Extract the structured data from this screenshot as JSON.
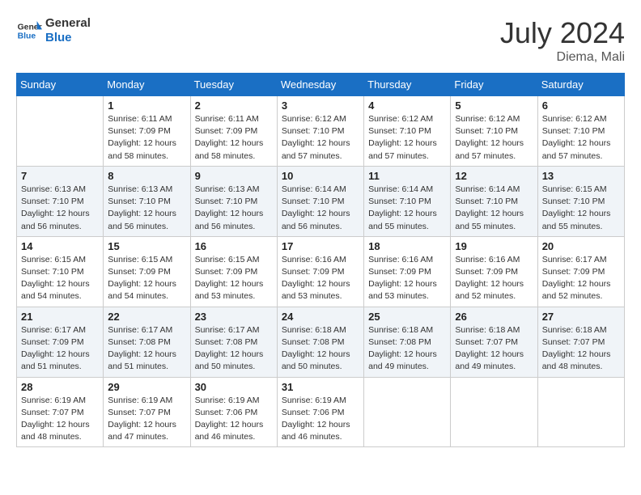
{
  "header": {
    "logo_general": "General",
    "logo_blue": "Blue",
    "month": "July 2024",
    "location": "Diema, Mali"
  },
  "weekdays": [
    "Sunday",
    "Monday",
    "Tuesday",
    "Wednesday",
    "Thursday",
    "Friday",
    "Saturday"
  ],
  "weeks": [
    [
      {
        "day": "",
        "sunrise": "",
        "sunset": "",
        "daylight": ""
      },
      {
        "day": "1",
        "sunrise": "Sunrise: 6:11 AM",
        "sunset": "Sunset: 7:09 PM",
        "daylight": "Daylight: 12 hours and 58 minutes."
      },
      {
        "day": "2",
        "sunrise": "Sunrise: 6:11 AM",
        "sunset": "Sunset: 7:09 PM",
        "daylight": "Daylight: 12 hours and 58 minutes."
      },
      {
        "day": "3",
        "sunrise": "Sunrise: 6:12 AM",
        "sunset": "Sunset: 7:10 PM",
        "daylight": "Daylight: 12 hours and 57 minutes."
      },
      {
        "day": "4",
        "sunrise": "Sunrise: 6:12 AM",
        "sunset": "Sunset: 7:10 PM",
        "daylight": "Daylight: 12 hours and 57 minutes."
      },
      {
        "day": "5",
        "sunrise": "Sunrise: 6:12 AM",
        "sunset": "Sunset: 7:10 PM",
        "daylight": "Daylight: 12 hours and 57 minutes."
      },
      {
        "day": "6",
        "sunrise": "Sunrise: 6:12 AM",
        "sunset": "Sunset: 7:10 PM",
        "daylight": "Daylight: 12 hours and 57 minutes."
      }
    ],
    [
      {
        "day": "7",
        "sunrise": "Sunrise: 6:13 AM",
        "sunset": "Sunset: 7:10 PM",
        "daylight": "Daylight: 12 hours and 56 minutes."
      },
      {
        "day": "8",
        "sunrise": "Sunrise: 6:13 AM",
        "sunset": "Sunset: 7:10 PM",
        "daylight": "Daylight: 12 hours and 56 minutes."
      },
      {
        "day": "9",
        "sunrise": "Sunrise: 6:13 AM",
        "sunset": "Sunset: 7:10 PM",
        "daylight": "Daylight: 12 hours and 56 minutes."
      },
      {
        "day": "10",
        "sunrise": "Sunrise: 6:14 AM",
        "sunset": "Sunset: 7:10 PM",
        "daylight": "Daylight: 12 hours and 56 minutes."
      },
      {
        "day": "11",
        "sunrise": "Sunrise: 6:14 AM",
        "sunset": "Sunset: 7:10 PM",
        "daylight": "Daylight: 12 hours and 55 minutes."
      },
      {
        "day": "12",
        "sunrise": "Sunrise: 6:14 AM",
        "sunset": "Sunset: 7:10 PM",
        "daylight": "Daylight: 12 hours and 55 minutes."
      },
      {
        "day": "13",
        "sunrise": "Sunrise: 6:15 AM",
        "sunset": "Sunset: 7:10 PM",
        "daylight": "Daylight: 12 hours and 55 minutes."
      }
    ],
    [
      {
        "day": "14",
        "sunrise": "Sunrise: 6:15 AM",
        "sunset": "Sunset: 7:10 PM",
        "daylight": "Daylight: 12 hours and 54 minutes."
      },
      {
        "day": "15",
        "sunrise": "Sunrise: 6:15 AM",
        "sunset": "Sunset: 7:09 PM",
        "daylight": "Daylight: 12 hours and 54 minutes."
      },
      {
        "day": "16",
        "sunrise": "Sunrise: 6:15 AM",
        "sunset": "Sunset: 7:09 PM",
        "daylight": "Daylight: 12 hours and 53 minutes."
      },
      {
        "day": "17",
        "sunrise": "Sunrise: 6:16 AM",
        "sunset": "Sunset: 7:09 PM",
        "daylight": "Daylight: 12 hours and 53 minutes."
      },
      {
        "day": "18",
        "sunrise": "Sunrise: 6:16 AM",
        "sunset": "Sunset: 7:09 PM",
        "daylight": "Daylight: 12 hours and 53 minutes."
      },
      {
        "day": "19",
        "sunrise": "Sunrise: 6:16 AM",
        "sunset": "Sunset: 7:09 PM",
        "daylight": "Daylight: 12 hours and 52 minutes."
      },
      {
        "day": "20",
        "sunrise": "Sunrise: 6:17 AM",
        "sunset": "Sunset: 7:09 PM",
        "daylight": "Daylight: 12 hours and 52 minutes."
      }
    ],
    [
      {
        "day": "21",
        "sunrise": "Sunrise: 6:17 AM",
        "sunset": "Sunset: 7:09 PM",
        "daylight": "Daylight: 12 hours and 51 minutes."
      },
      {
        "day": "22",
        "sunrise": "Sunrise: 6:17 AM",
        "sunset": "Sunset: 7:08 PM",
        "daylight": "Daylight: 12 hours and 51 minutes."
      },
      {
        "day": "23",
        "sunrise": "Sunrise: 6:17 AM",
        "sunset": "Sunset: 7:08 PM",
        "daylight": "Daylight: 12 hours and 50 minutes."
      },
      {
        "day": "24",
        "sunrise": "Sunrise: 6:18 AM",
        "sunset": "Sunset: 7:08 PM",
        "daylight": "Daylight: 12 hours and 50 minutes."
      },
      {
        "day": "25",
        "sunrise": "Sunrise: 6:18 AM",
        "sunset": "Sunset: 7:08 PM",
        "daylight": "Daylight: 12 hours and 49 minutes."
      },
      {
        "day": "26",
        "sunrise": "Sunrise: 6:18 AM",
        "sunset": "Sunset: 7:07 PM",
        "daylight": "Daylight: 12 hours and 49 minutes."
      },
      {
        "day": "27",
        "sunrise": "Sunrise: 6:18 AM",
        "sunset": "Sunset: 7:07 PM",
        "daylight": "Daylight: 12 hours and 48 minutes."
      }
    ],
    [
      {
        "day": "28",
        "sunrise": "Sunrise: 6:19 AM",
        "sunset": "Sunset: 7:07 PM",
        "daylight": "Daylight: 12 hours and 48 minutes."
      },
      {
        "day": "29",
        "sunrise": "Sunrise: 6:19 AM",
        "sunset": "Sunset: 7:07 PM",
        "daylight": "Daylight: 12 hours and 47 minutes."
      },
      {
        "day": "30",
        "sunrise": "Sunrise: 6:19 AM",
        "sunset": "Sunset: 7:06 PM",
        "daylight": "Daylight: 12 hours and 46 minutes."
      },
      {
        "day": "31",
        "sunrise": "Sunrise: 6:19 AM",
        "sunset": "Sunset: 7:06 PM",
        "daylight": "Daylight: 12 hours and 46 minutes."
      },
      {
        "day": "",
        "sunrise": "",
        "sunset": "",
        "daylight": ""
      },
      {
        "day": "",
        "sunrise": "",
        "sunset": "",
        "daylight": ""
      },
      {
        "day": "",
        "sunrise": "",
        "sunset": "",
        "daylight": ""
      }
    ]
  ]
}
